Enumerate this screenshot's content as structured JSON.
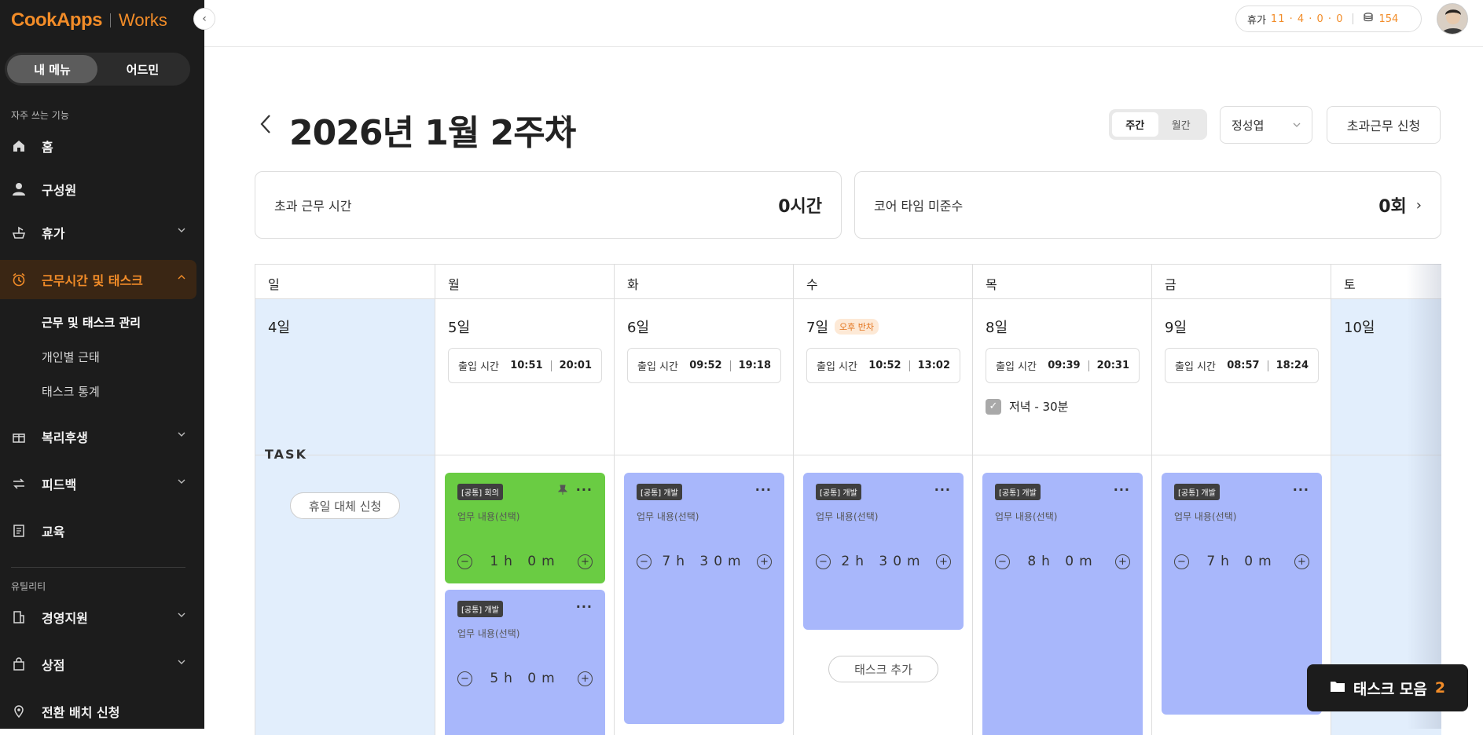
{
  "brand": {
    "name": "CookApps",
    "product": "Works"
  },
  "sidebar": {
    "toggle": [
      "내 메뉴",
      "어드민"
    ],
    "section_frequent": "자주 쓰는 기능",
    "items": [
      {
        "label": "홈",
        "icon": "home-icon"
      },
      {
        "label": "구성원",
        "icon": "person-icon"
      },
      {
        "label": "휴가",
        "icon": "vacation-icon"
      },
      {
        "label": "근무시간 및 태스크",
        "icon": "alarm-icon"
      },
      {
        "label": "복리후생",
        "icon": "gift-icon"
      },
      {
        "label": "피드백",
        "icon": "feedback-icon"
      },
      {
        "label": "교육",
        "icon": "book-icon"
      }
    ],
    "subitems": [
      "근무 및 태스크 관리",
      "개인별 근태",
      "태스크 통계"
    ],
    "section_utility": "유틸리티",
    "utility_items": [
      {
        "label": "경영지원",
        "icon": "building-icon"
      },
      {
        "label": "상점",
        "icon": "shop-icon"
      },
      {
        "label": "전환 배치 신청",
        "icon": "location-icon"
      }
    ]
  },
  "topbar": {
    "vacation_label": "휴가",
    "vacation_nums": "11 · 4 · 0 · 0",
    "points": "154"
  },
  "header": {
    "title": "2026년 1월 2주차",
    "view_weekly": "주간",
    "view_monthly": "월간",
    "user": "정성엽",
    "overtime_button": "초과근무 신청"
  },
  "stats": {
    "overtime_label": "초과 근무 시간",
    "overtime_value": "0시간",
    "core_label": "코어 타임 미준수",
    "core_value": "0회"
  },
  "calendar": {
    "task_label": "TASK",
    "checkin_label": "출입 시간",
    "days": [
      {
        "dow": "일",
        "date": "4일"
      },
      {
        "dow": "월",
        "date": "5일",
        "in": "10:51",
        "out": "20:01"
      },
      {
        "dow": "화",
        "date": "6일",
        "in": "09:52",
        "out": "19:18"
      },
      {
        "dow": "수",
        "date": "7일",
        "badge": "오후 반차",
        "in": "10:52",
        "out": "13:02"
      },
      {
        "dow": "목",
        "date": "8일",
        "in": "09:39",
        "out": "20:31",
        "dinner": "저녁 - 30분"
      },
      {
        "dow": "금",
        "date": "9일",
        "in": "08:57",
        "out": "18:24"
      },
      {
        "dow": "토",
        "date": "10일"
      }
    ],
    "holiday_replace": "휴일 대체 신청",
    "add_task": "태스크 추가",
    "tasks": [
      {
        "tag": "[공통] 회의",
        "desc": "업무 내용(선택)",
        "duration": "1h 0m"
      },
      {
        "tag": "[공통] 개발",
        "desc": "업무 내용(선택)",
        "duration": "5h 0m"
      },
      {
        "tag": "[공통] 개발",
        "desc": "업무 내용(선택)",
        "duration": "7h 30m"
      },
      {
        "tag": "[공통] 개발",
        "desc": "업무 내용(선택)",
        "duration": "2h 30m"
      },
      {
        "tag": "[공통] 개발",
        "desc": "업무 내용(선택)",
        "duration": "8h 0m"
      },
      {
        "tag": "[공통] 개발",
        "desc": "업무 내용(선택)",
        "duration": "7h 0m"
      }
    ]
  },
  "task_collection": {
    "label": "태스크 모음",
    "count": "2"
  },
  "colors": {
    "accent": "#f28c28",
    "task_green": "#6acc43",
    "task_blue": "#a8b7fb",
    "weekend_bg": "#e2eefc"
  }
}
